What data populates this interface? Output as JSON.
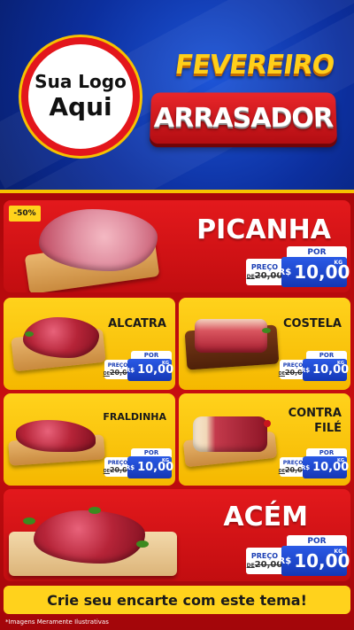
{
  "header": {
    "logo_line1": "Sua Logo",
    "logo_line2": "Aqui",
    "title_line1": "FEVEREIRO",
    "title_line2": "ARRASADOR"
  },
  "price_tag": {
    "por": "POR",
    "preco": "PREÇO",
    "old_prefix": "DE",
    "old_price": "20,00",
    "currency": "R$",
    "new_price": "10,00",
    "unit": "KG"
  },
  "products": [
    {
      "name": "PICANHA",
      "discount": "-50%"
    },
    {
      "name": "ALCATRA"
    },
    {
      "name": "COSTELA"
    },
    {
      "name": "FRALDINHA"
    },
    {
      "name": "CONTRA FILÉ"
    },
    {
      "name": "ACÉM"
    }
  ],
  "banner": "Crie seu encarte com este tema!",
  "footnote": "*Imagens Meramente Ilustrativas",
  "colors": {
    "header_blue": "#0c2f9e",
    "red": "#e3191c",
    "yellow": "#ffd21c",
    "price_blue": "#1437b5"
  }
}
